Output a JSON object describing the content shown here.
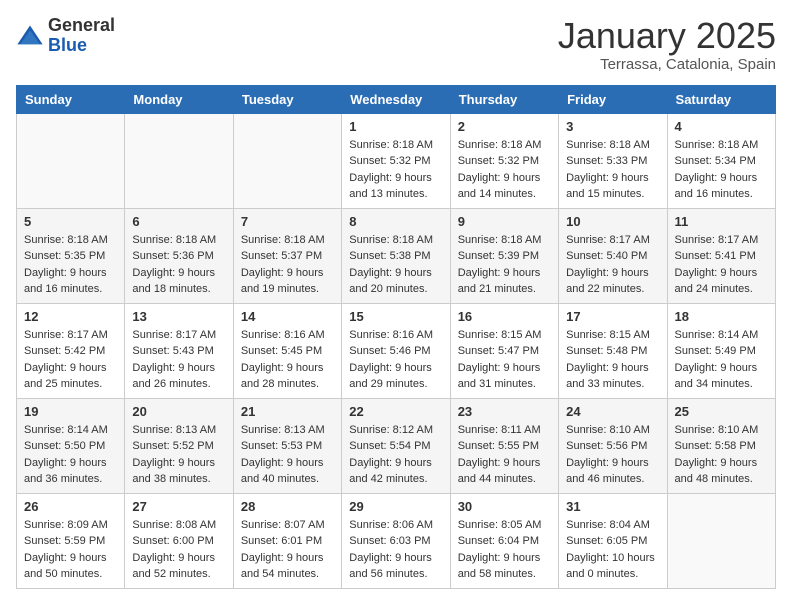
{
  "header": {
    "logo_general": "General",
    "logo_blue": "Blue",
    "month_title": "January 2025",
    "location": "Terrassa, Catalonia, Spain"
  },
  "weekdays": [
    "Sunday",
    "Monday",
    "Tuesday",
    "Wednesday",
    "Thursday",
    "Friday",
    "Saturday"
  ],
  "weeks": [
    [
      {
        "day": "",
        "sunrise": "",
        "sunset": "",
        "daylight": ""
      },
      {
        "day": "",
        "sunrise": "",
        "sunset": "",
        "daylight": ""
      },
      {
        "day": "",
        "sunrise": "",
        "sunset": "",
        "daylight": ""
      },
      {
        "day": "1",
        "sunrise": "Sunrise: 8:18 AM",
        "sunset": "Sunset: 5:32 PM",
        "daylight": "Daylight: 9 hours and 13 minutes."
      },
      {
        "day": "2",
        "sunrise": "Sunrise: 8:18 AM",
        "sunset": "Sunset: 5:32 PM",
        "daylight": "Daylight: 9 hours and 14 minutes."
      },
      {
        "day": "3",
        "sunrise": "Sunrise: 8:18 AM",
        "sunset": "Sunset: 5:33 PM",
        "daylight": "Daylight: 9 hours and 15 minutes."
      },
      {
        "day": "4",
        "sunrise": "Sunrise: 8:18 AM",
        "sunset": "Sunset: 5:34 PM",
        "daylight": "Daylight: 9 hours and 16 minutes."
      }
    ],
    [
      {
        "day": "5",
        "sunrise": "Sunrise: 8:18 AM",
        "sunset": "Sunset: 5:35 PM",
        "daylight": "Daylight: 9 hours and 16 minutes."
      },
      {
        "day": "6",
        "sunrise": "Sunrise: 8:18 AM",
        "sunset": "Sunset: 5:36 PM",
        "daylight": "Daylight: 9 hours and 18 minutes."
      },
      {
        "day": "7",
        "sunrise": "Sunrise: 8:18 AM",
        "sunset": "Sunset: 5:37 PM",
        "daylight": "Daylight: 9 hours and 19 minutes."
      },
      {
        "day": "8",
        "sunrise": "Sunrise: 8:18 AM",
        "sunset": "Sunset: 5:38 PM",
        "daylight": "Daylight: 9 hours and 20 minutes."
      },
      {
        "day": "9",
        "sunrise": "Sunrise: 8:18 AM",
        "sunset": "Sunset: 5:39 PM",
        "daylight": "Daylight: 9 hours and 21 minutes."
      },
      {
        "day": "10",
        "sunrise": "Sunrise: 8:17 AM",
        "sunset": "Sunset: 5:40 PM",
        "daylight": "Daylight: 9 hours and 22 minutes."
      },
      {
        "day": "11",
        "sunrise": "Sunrise: 8:17 AM",
        "sunset": "Sunset: 5:41 PM",
        "daylight": "Daylight: 9 hours and 24 minutes."
      }
    ],
    [
      {
        "day": "12",
        "sunrise": "Sunrise: 8:17 AM",
        "sunset": "Sunset: 5:42 PM",
        "daylight": "Daylight: 9 hours and 25 minutes."
      },
      {
        "day": "13",
        "sunrise": "Sunrise: 8:17 AM",
        "sunset": "Sunset: 5:43 PM",
        "daylight": "Daylight: 9 hours and 26 minutes."
      },
      {
        "day": "14",
        "sunrise": "Sunrise: 8:16 AM",
        "sunset": "Sunset: 5:45 PM",
        "daylight": "Daylight: 9 hours and 28 minutes."
      },
      {
        "day": "15",
        "sunrise": "Sunrise: 8:16 AM",
        "sunset": "Sunset: 5:46 PM",
        "daylight": "Daylight: 9 hours and 29 minutes."
      },
      {
        "day": "16",
        "sunrise": "Sunrise: 8:15 AM",
        "sunset": "Sunset: 5:47 PM",
        "daylight": "Daylight: 9 hours and 31 minutes."
      },
      {
        "day": "17",
        "sunrise": "Sunrise: 8:15 AM",
        "sunset": "Sunset: 5:48 PM",
        "daylight": "Daylight: 9 hours and 33 minutes."
      },
      {
        "day": "18",
        "sunrise": "Sunrise: 8:14 AM",
        "sunset": "Sunset: 5:49 PM",
        "daylight": "Daylight: 9 hours and 34 minutes."
      }
    ],
    [
      {
        "day": "19",
        "sunrise": "Sunrise: 8:14 AM",
        "sunset": "Sunset: 5:50 PM",
        "daylight": "Daylight: 9 hours and 36 minutes."
      },
      {
        "day": "20",
        "sunrise": "Sunrise: 8:13 AM",
        "sunset": "Sunset: 5:52 PM",
        "daylight": "Daylight: 9 hours and 38 minutes."
      },
      {
        "day": "21",
        "sunrise": "Sunrise: 8:13 AM",
        "sunset": "Sunset: 5:53 PM",
        "daylight": "Daylight: 9 hours and 40 minutes."
      },
      {
        "day": "22",
        "sunrise": "Sunrise: 8:12 AM",
        "sunset": "Sunset: 5:54 PM",
        "daylight": "Daylight: 9 hours and 42 minutes."
      },
      {
        "day": "23",
        "sunrise": "Sunrise: 8:11 AM",
        "sunset": "Sunset: 5:55 PM",
        "daylight": "Daylight: 9 hours and 44 minutes."
      },
      {
        "day": "24",
        "sunrise": "Sunrise: 8:10 AM",
        "sunset": "Sunset: 5:56 PM",
        "daylight": "Daylight: 9 hours and 46 minutes."
      },
      {
        "day": "25",
        "sunrise": "Sunrise: 8:10 AM",
        "sunset": "Sunset: 5:58 PM",
        "daylight": "Daylight: 9 hours and 48 minutes."
      }
    ],
    [
      {
        "day": "26",
        "sunrise": "Sunrise: 8:09 AM",
        "sunset": "Sunset: 5:59 PM",
        "daylight": "Daylight: 9 hours and 50 minutes."
      },
      {
        "day": "27",
        "sunrise": "Sunrise: 8:08 AM",
        "sunset": "Sunset: 6:00 PM",
        "daylight": "Daylight: 9 hours and 52 minutes."
      },
      {
        "day": "28",
        "sunrise": "Sunrise: 8:07 AM",
        "sunset": "Sunset: 6:01 PM",
        "daylight": "Daylight: 9 hours and 54 minutes."
      },
      {
        "day": "29",
        "sunrise": "Sunrise: 8:06 AM",
        "sunset": "Sunset: 6:03 PM",
        "daylight": "Daylight: 9 hours and 56 minutes."
      },
      {
        "day": "30",
        "sunrise": "Sunrise: 8:05 AM",
        "sunset": "Sunset: 6:04 PM",
        "daylight": "Daylight: 9 hours and 58 minutes."
      },
      {
        "day": "31",
        "sunrise": "Sunrise: 8:04 AM",
        "sunset": "Sunset: 6:05 PM",
        "daylight": "Daylight: 10 hours and 0 minutes."
      },
      {
        "day": "",
        "sunrise": "",
        "sunset": "",
        "daylight": ""
      }
    ]
  ]
}
